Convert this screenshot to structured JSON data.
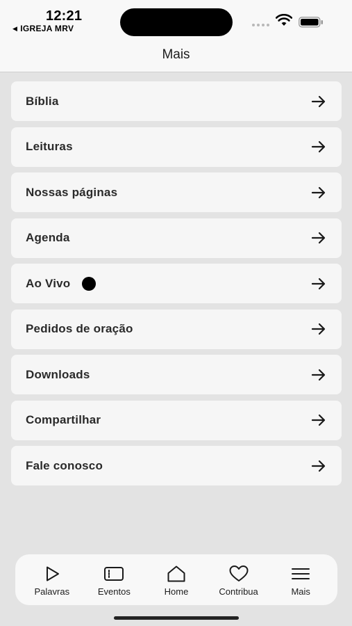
{
  "status_bar": {
    "time": "12:21",
    "back_app": "IGREJA MRV",
    "back_glyph": "◀"
  },
  "header": {
    "title": "Mais"
  },
  "menu": {
    "items": [
      {
        "label": "Bíblia"
      },
      {
        "label": "Leituras"
      },
      {
        "label": "Nossas páginas"
      },
      {
        "label": "Agenda"
      },
      {
        "label": "Ao Vivo",
        "live_indicator": true
      },
      {
        "label": "Pedidos de oração"
      },
      {
        "label": "Downloads"
      },
      {
        "label": "Compartilhar"
      },
      {
        "label": "Fale conosco"
      }
    ],
    "item_icon": "arrow-right-icon"
  },
  "tabbar": {
    "tabs": [
      {
        "label": "Palavras",
        "icon": "play-icon"
      },
      {
        "label": "Eventos",
        "icon": "ticket-icon"
      },
      {
        "label": "Home",
        "icon": "home-icon"
      },
      {
        "label": "Contribua",
        "icon": "heart-icon"
      },
      {
        "label": "Mais",
        "icon": "menu-icon",
        "active": true
      }
    ]
  },
  "colors": {
    "background": "#e3e3e3",
    "card": "#f6f6f6",
    "header": "#f8f8f8",
    "text": "#2a2a2a"
  }
}
